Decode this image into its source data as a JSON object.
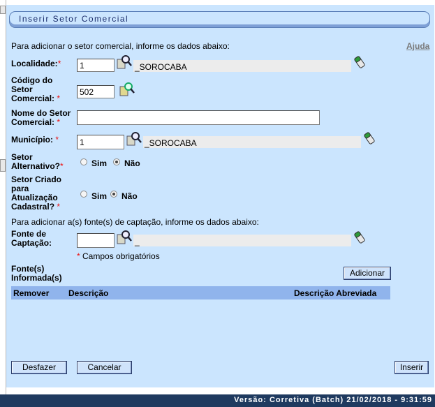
{
  "header": {
    "title": "Inserir Setor Comercial"
  },
  "intro": "Para adicionar o setor comercial, informe os dados abaixo:",
  "help_link": "Ajuda",
  "localidade": {
    "label": "Localidade:",
    "required": "*",
    "value": "1",
    "description": "_SOROCABA"
  },
  "codigo": {
    "label_line1": "Código do",
    "label_line2": "Setor",
    "label_line3": "Comercial:",
    "required": "*",
    "value": "502"
  },
  "nome": {
    "label_line1": "Nome do Setor",
    "label_line2": "Comercial:",
    "required": "*",
    "value": ""
  },
  "municipio": {
    "label": "Município:",
    "required": "*",
    "value": "1",
    "description": "_SOROCABA"
  },
  "setor_alternativo": {
    "label_line1": "Setor",
    "label_line2": "Alternativo?",
    "required": "*",
    "opt_sim": "Sim",
    "opt_nao": "Não",
    "selected": "Não"
  },
  "setor_criado": {
    "label_line1": "Setor Criado",
    "label_line2": "para",
    "label_line3": "Atualização",
    "label_line4": "Cadastral?",
    "required": "*",
    "opt_sim": "Sim",
    "opt_nao": "Não",
    "selected": "Não"
  },
  "fonte_intro": "Para adicionar a(s) fonte(s) de captação, informe os dados abaixo:",
  "fonte": {
    "label_line1": "Fonte de",
    "label_line2": "Captação:",
    "value": "",
    "description": "_"
  },
  "required_note": {
    "star": "*",
    "text": "Campos obrigatórios"
  },
  "fontes_informadas": {
    "label_line1": "Fonte(s)",
    "label_line2": "Informada(s)"
  },
  "buttons": {
    "adicionar": "Adicionar",
    "desfazer": "Desfazer",
    "cancelar": "Cancelar",
    "inserir": "Inserir"
  },
  "table": {
    "columns": [
      "Remover",
      "Descrição",
      "Descrição Abreviada"
    ],
    "rows": []
  },
  "footer": {
    "version": "Versão: Corretiva (Batch) 21/02/2018 - 9:31:59"
  },
  "icons": {
    "search": "search-magnifier-icon",
    "clear": "eraser-icon"
  },
  "colors": {
    "panel": "#cbe5fe",
    "table_header": "#90b4ec",
    "footer": "#1f3a5f",
    "required": "#e11111"
  }
}
